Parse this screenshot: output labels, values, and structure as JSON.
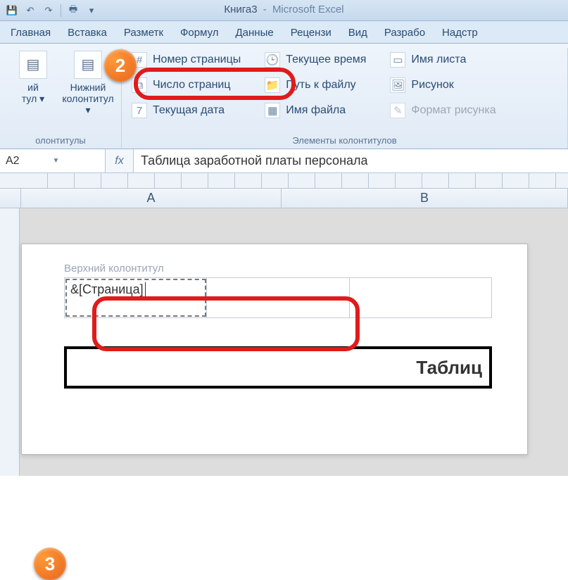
{
  "app": {
    "bookname": "Книга3",
    "dash": "-",
    "appname": "Microsoft Excel"
  },
  "qat": {
    "save": "💾",
    "undo": "↶",
    "redo": "↷",
    "print": "🖶",
    "customize": "▾"
  },
  "tabs": [
    "Главная",
    "Вставка",
    "Разметк",
    "Формул",
    "Данные",
    "Рецензи",
    "Вид",
    "Разрабо",
    "Надстр"
  ],
  "ribbon": {
    "group1": {
      "label": "олонтитулы",
      "btn1": {
        "line1": "ий",
        "line2": "тул ▾"
      },
      "btn2": {
        "line1": "Нижний",
        "line2": "колонтитул ▾"
      }
    },
    "group2": {
      "label": "Элементы колонтитулов",
      "col1": {
        "pagenum": "Номер страницы",
        "pagecount": "Число страниц",
        "curdate": "Текущая дата"
      },
      "col2": {
        "curtime": "Текущее время",
        "filepath": "Путь к файлу",
        "filename": "Имя файла"
      },
      "col3": {
        "sheetname": "Имя листа",
        "picture": "Рисунок",
        "fmtpic": "Формат рисунка"
      }
    }
  },
  "steps": {
    "s2": "2",
    "s3": "3"
  },
  "fbar": {
    "cellref": "A2",
    "fx": "fx",
    "formula": "Таблица заработной платы персонала"
  },
  "columns": {
    "A": "A",
    "B": "B"
  },
  "header_footer": {
    "label": "Верхний колонтитул",
    "left_value": "&[Страница]"
  },
  "tablebelow": "Таблиц"
}
